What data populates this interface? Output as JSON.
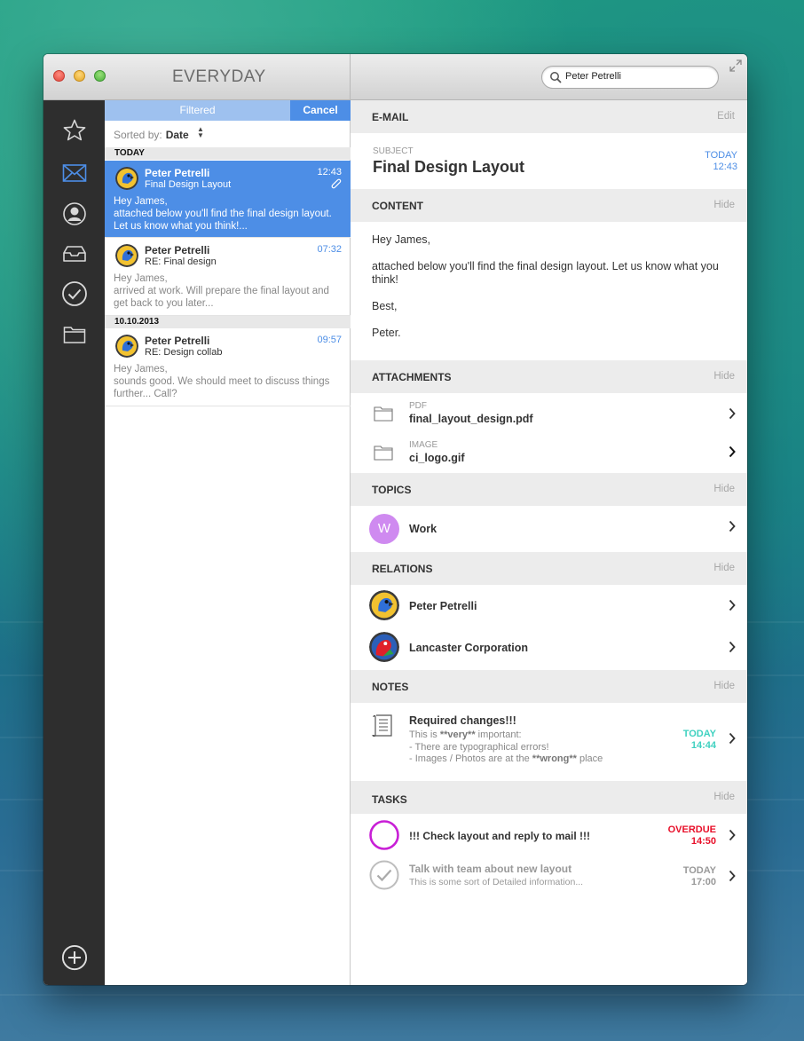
{
  "window": {
    "app_title": "EVERYDAY",
    "search": {
      "value": "Peter Petrelli"
    }
  },
  "sidebar": {
    "items": [
      {
        "name": "star-icon"
      },
      {
        "name": "mail-icon",
        "active": true
      },
      {
        "name": "contact-icon"
      },
      {
        "name": "inbox-tray-icon"
      },
      {
        "name": "check-circle-icon"
      },
      {
        "name": "folder-icon"
      }
    ],
    "add": {
      "name": "add-circle-icon"
    }
  },
  "list": {
    "filtered_label": "Filtered",
    "cancel_label": "Cancel",
    "sort_label": "Sorted by:",
    "sort_value": "Date",
    "sections": [
      {
        "label": "TODAY"
      },
      {
        "label": "10.10.2013"
      }
    ],
    "mails": [
      {
        "from": "Peter Petrelli",
        "subject": "Final Design Layout",
        "time": "12:43",
        "body": "Hey James,\nattached below you'll find the final design layout. Let us know what you think!...",
        "selected": true,
        "attachment": true
      },
      {
        "from": "Peter Petrelli",
        "subject": "RE: Final design",
        "time": "07:32",
        "body": "Hey James,\narrived at work. Will prepare the final layout and get back to you later..."
      },
      {
        "from": "Peter Petrelli",
        "subject": "RE: Design collab",
        "time": "09:57",
        "body": "Hey James,\nsounds good. We should meet to discuss things further... Call?"
      }
    ]
  },
  "detail": {
    "email": {
      "header": "E-MAIL",
      "action": "Edit",
      "subject_label": "SUBJECT",
      "subject": "Final Design Layout",
      "date_day": "TODAY",
      "date_time": "12:43"
    },
    "content": {
      "header": "CONTENT",
      "action": "Hide",
      "lines": [
        "Hey James,",
        "attached below you'll find the final design layout. Let us know what you think!",
        "Best,",
        "Peter."
      ]
    },
    "attachments": {
      "header": "ATTACHMENTS",
      "action": "Hide",
      "items": [
        {
          "type": "PDF",
          "name": "final_layout_design.pdf"
        },
        {
          "type": "IMAGE",
          "name": "ci_logo.gif"
        }
      ]
    },
    "topics": {
      "header": "TOPICS",
      "action": "Hide",
      "items": [
        {
          "initial": "W",
          "name": "Work",
          "color": "#cf8af0"
        }
      ]
    },
    "relations": {
      "header": "RELATIONS",
      "action": "Hide",
      "items": [
        {
          "name": "Peter Petrelli"
        },
        {
          "name": "Lancaster Corporation"
        }
      ]
    },
    "notes": {
      "header": "NOTES",
      "action": "Hide",
      "items": [
        {
          "title": "Required changes!!!",
          "line1_pre": "This is ",
          "line1_bold": "**very**",
          "line1_post": " important:",
          "line2": "- There are typographical errors!",
          "line3_pre": "- Images / Photos are at the ",
          "line3_bold": "**wrong**",
          "line3_post": " place",
          "date_day": "TODAY",
          "date_time": "14:44",
          "date_color": "#3fd1c0"
        }
      ]
    },
    "tasks": {
      "header": "TASKS",
      "action": "Hide",
      "items": [
        {
          "title": "!!! Check layout and reply to mail !!!",
          "date_day": "OVERDUE",
          "date_time": "14:50",
          "date_color": "#e8102a",
          "ring_color": "#c81fd6"
        },
        {
          "title": "Talk with team about new layout",
          "subtitle": "This is some sort of Detailed information...",
          "date_day": "TODAY",
          "date_time": "17:00",
          "date_color": "#999999",
          "done": true
        }
      ]
    }
  },
  "colors": {
    "accent": "#4d8ee6",
    "sidebar": "#2e2e2e"
  }
}
